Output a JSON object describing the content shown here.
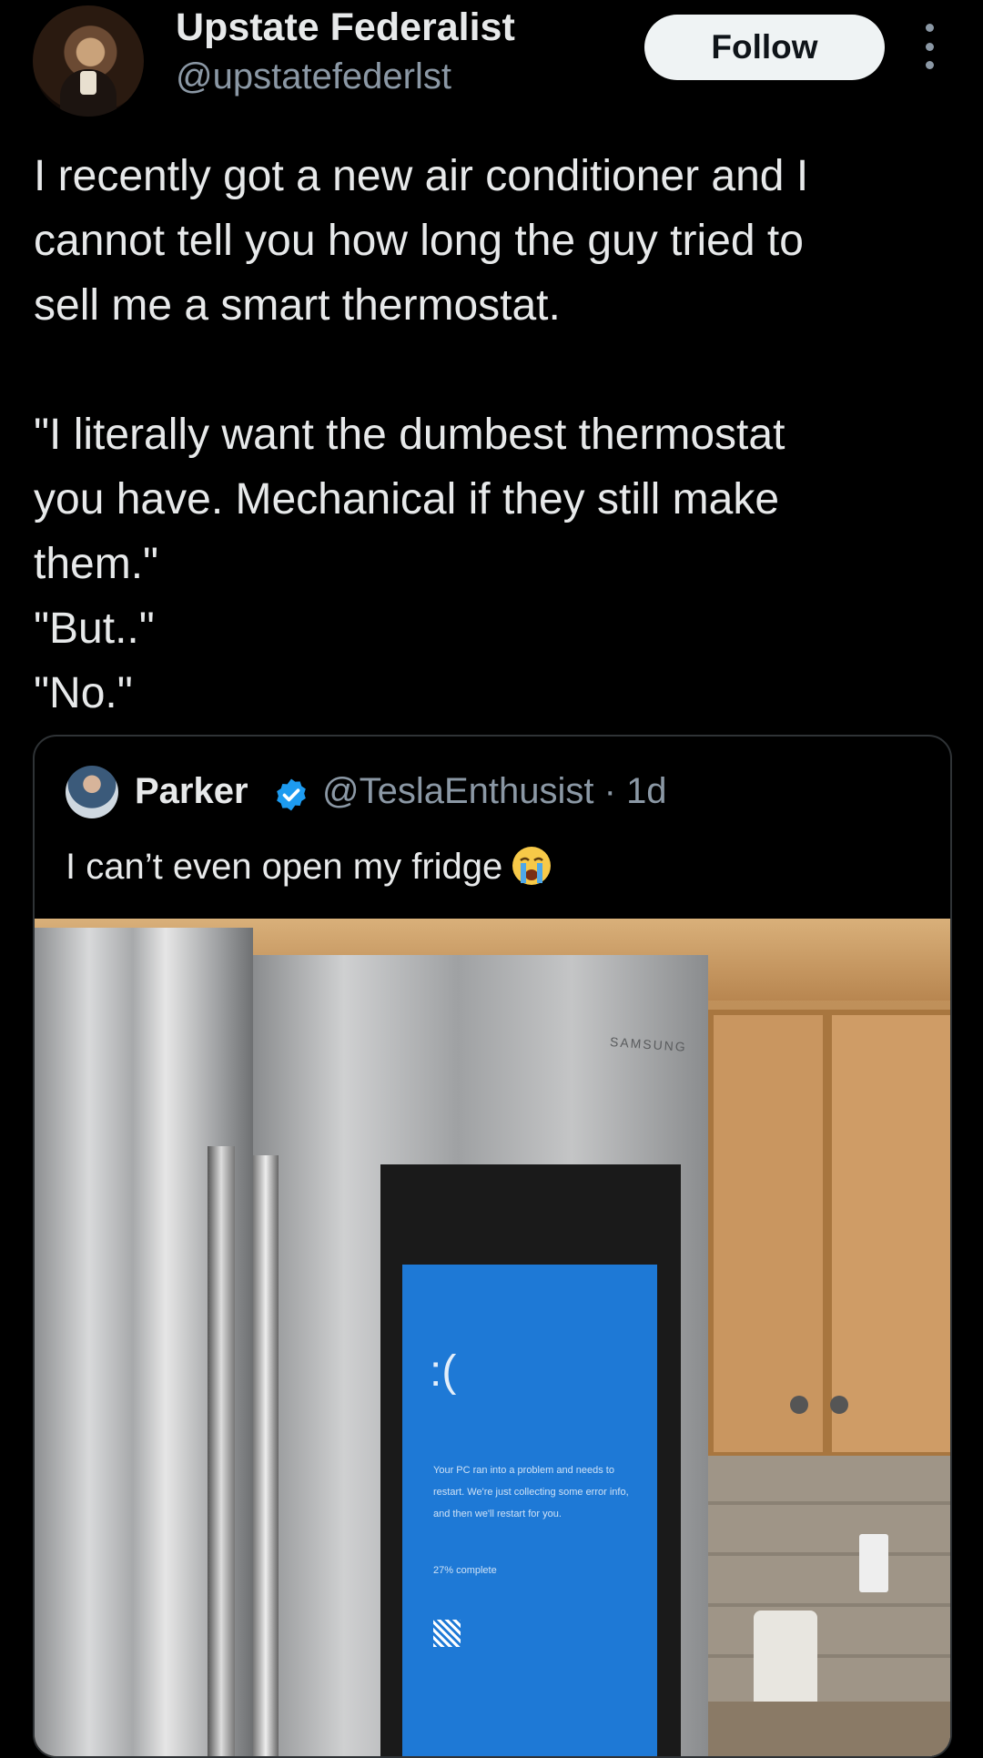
{
  "post": {
    "author_name": "Upstate Federalist",
    "author_handle": "@upstatefederlst",
    "follow_label": "Follow",
    "text_lines": [
      "I recently got a new air conditioner and I",
      "cannot tell you how long the guy tried to",
      "sell me a smart thermostat.",
      "",
      "\"I literally want the dumbest thermostat",
      "you have. Mechanical if they still make",
      "them.\"",
      "\"But..\"",
      "\"No.\""
    ]
  },
  "quote": {
    "author_name": "Parker",
    "meta": "@TeslaEnthusist · 1d",
    "text": "I can’t even open my fridge",
    "emoji_icon": "loudly-crying-face-icon",
    "photo": {
      "brand": "SAMSUNG",
      "screen_face": ":(",
      "screen_message": "Your PC ran into a problem and needs to restart. We're just collecting some error info, and then we'll restart for you.",
      "screen_progress": "27% complete"
    }
  },
  "colors": {
    "background": "#000000",
    "text": "#e7e9ea",
    "muted": "#8b98a5",
    "verified": "#1d9bf0",
    "bsod": "#1e79d6"
  }
}
